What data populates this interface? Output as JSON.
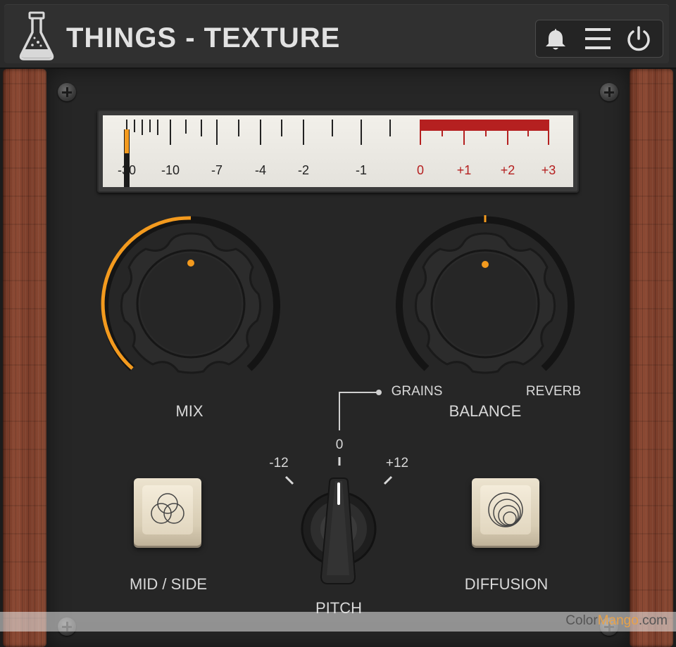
{
  "app": {
    "title": "THINGS - TEXTURE"
  },
  "toolbar": {
    "icons": [
      "bell-icon",
      "menu-icon",
      "power-icon"
    ]
  },
  "meter": {
    "scale_labels": [
      "-30",
      "-10",
      "-7",
      "-4",
      "-2",
      "-1",
      "0",
      "+1",
      "+2",
      "+3"
    ],
    "colors": {
      "normal": "#222222",
      "red_zone": "#b52020",
      "needle": "#f39a1e"
    }
  },
  "knobs": {
    "mix": {
      "label": "MIX",
      "value_fraction": 0.5
    },
    "balance": {
      "label": "BALANCE",
      "left_label": "GRAINS",
      "right_label": "REVERB",
      "value_fraction": 0.5
    }
  },
  "pitch": {
    "label": "PITCH",
    "scale": {
      "left": "-12",
      "center": "0",
      "right": "+12"
    }
  },
  "buttons": {
    "mid_side": "MID / SIDE",
    "diffusion": "DIFFUSION"
  },
  "watermark": {
    "part1": "Color",
    "part2": "Mango",
    "part3": ".com"
  },
  "colors": {
    "accent": "#f39a1e",
    "panel": "#262626",
    "text": "#d8d8d8"
  }
}
